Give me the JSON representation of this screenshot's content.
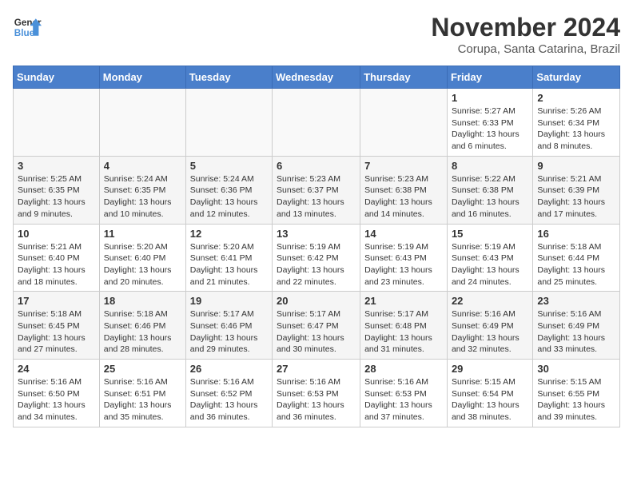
{
  "logo": {
    "general": "General",
    "blue": "Blue"
  },
  "title": "November 2024",
  "location": "Corupa, Santa Catarina, Brazil",
  "weekdays": [
    "Sunday",
    "Monday",
    "Tuesday",
    "Wednesday",
    "Thursday",
    "Friday",
    "Saturday"
  ],
  "weeks": [
    [
      {
        "day": "",
        "info": ""
      },
      {
        "day": "",
        "info": ""
      },
      {
        "day": "",
        "info": ""
      },
      {
        "day": "",
        "info": ""
      },
      {
        "day": "",
        "info": ""
      },
      {
        "day": "1",
        "info": "Sunrise: 5:27 AM\nSunset: 6:33 PM\nDaylight: 13 hours and 6 minutes."
      },
      {
        "day": "2",
        "info": "Sunrise: 5:26 AM\nSunset: 6:34 PM\nDaylight: 13 hours and 8 minutes."
      }
    ],
    [
      {
        "day": "3",
        "info": "Sunrise: 5:25 AM\nSunset: 6:35 PM\nDaylight: 13 hours and 9 minutes."
      },
      {
        "day": "4",
        "info": "Sunrise: 5:24 AM\nSunset: 6:35 PM\nDaylight: 13 hours and 10 minutes."
      },
      {
        "day": "5",
        "info": "Sunrise: 5:24 AM\nSunset: 6:36 PM\nDaylight: 13 hours and 12 minutes."
      },
      {
        "day": "6",
        "info": "Sunrise: 5:23 AM\nSunset: 6:37 PM\nDaylight: 13 hours and 13 minutes."
      },
      {
        "day": "7",
        "info": "Sunrise: 5:23 AM\nSunset: 6:38 PM\nDaylight: 13 hours and 14 minutes."
      },
      {
        "day": "8",
        "info": "Sunrise: 5:22 AM\nSunset: 6:38 PM\nDaylight: 13 hours and 16 minutes."
      },
      {
        "day": "9",
        "info": "Sunrise: 5:21 AM\nSunset: 6:39 PM\nDaylight: 13 hours and 17 minutes."
      }
    ],
    [
      {
        "day": "10",
        "info": "Sunrise: 5:21 AM\nSunset: 6:40 PM\nDaylight: 13 hours and 18 minutes."
      },
      {
        "day": "11",
        "info": "Sunrise: 5:20 AM\nSunset: 6:40 PM\nDaylight: 13 hours and 20 minutes."
      },
      {
        "day": "12",
        "info": "Sunrise: 5:20 AM\nSunset: 6:41 PM\nDaylight: 13 hours and 21 minutes."
      },
      {
        "day": "13",
        "info": "Sunrise: 5:19 AM\nSunset: 6:42 PM\nDaylight: 13 hours and 22 minutes."
      },
      {
        "day": "14",
        "info": "Sunrise: 5:19 AM\nSunset: 6:43 PM\nDaylight: 13 hours and 23 minutes."
      },
      {
        "day": "15",
        "info": "Sunrise: 5:19 AM\nSunset: 6:43 PM\nDaylight: 13 hours and 24 minutes."
      },
      {
        "day": "16",
        "info": "Sunrise: 5:18 AM\nSunset: 6:44 PM\nDaylight: 13 hours and 25 minutes."
      }
    ],
    [
      {
        "day": "17",
        "info": "Sunrise: 5:18 AM\nSunset: 6:45 PM\nDaylight: 13 hours and 27 minutes."
      },
      {
        "day": "18",
        "info": "Sunrise: 5:18 AM\nSunset: 6:46 PM\nDaylight: 13 hours and 28 minutes."
      },
      {
        "day": "19",
        "info": "Sunrise: 5:17 AM\nSunset: 6:46 PM\nDaylight: 13 hours and 29 minutes."
      },
      {
        "day": "20",
        "info": "Sunrise: 5:17 AM\nSunset: 6:47 PM\nDaylight: 13 hours and 30 minutes."
      },
      {
        "day": "21",
        "info": "Sunrise: 5:17 AM\nSunset: 6:48 PM\nDaylight: 13 hours and 31 minutes."
      },
      {
        "day": "22",
        "info": "Sunrise: 5:16 AM\nSunset: 6:49 PM\nDaylight: 13 hours and 32 minutes."
      },
      {
        "day": "23",
        "info": "Sunrise: 5:16 AM\nSunset: 6:49 PM\nDaylight: 13 hours and 33 minutes."
      }
    ],
    [
      {
        "day": "24",
        "info": "Sunrise: 5:16 AM\nSunset: 6:50 PM\nDaylight: 13 hours and 34 minutes."
      },
      {
        "day": "25",
        "info": "Sunrise: 5:16 AM\nSunset: 6:51 PM\nDaylight: 13 hours and 35 minutes."
      },
      {
        "day": "26",
        "info": "Sunrise: 5:16 AM\nSunset: 6:52 PM\nDaylight: 13 hours and 36 minutes."
      },
      {
        "day": "27",
        "info": "Sunrise: 5:16 AM\nSunset: 6:53 PM\nDaylight: 13 hours and 36 minutes."
      },
      {
        "day": "28",
        "info": "Sunrise: 5:16 AM\nSunset: 6:53 PM\nDaylight: 13 hours and 37 minutes."
      },
      {
        "day": "29",
        "info": "Sunrise: 5:15 AM\nSunset: 6:54 PM\nDaylight: 13 hours and 38 minutes."
      },
      {
        "day": "30",
        "info": "Sunrise: 5:15 AM\nSunset: 6:55 PM\nDaylight: 13 hours and 39 minutes."
      }
    ]
  ]
}
